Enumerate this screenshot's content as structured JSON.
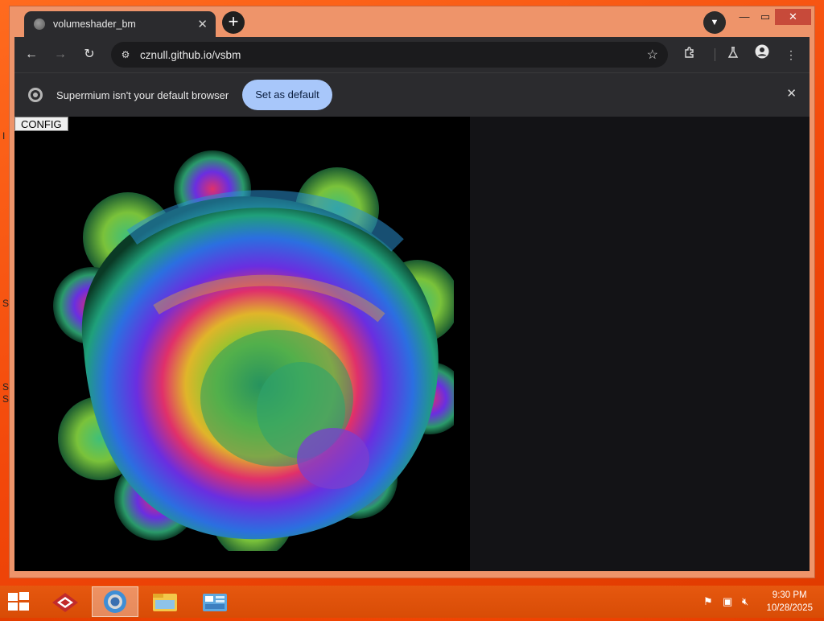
{
  "desktop": {
    "chars": [
      "I",
      "S",
      "S",
      "S"
    ]
  },
  "browser": {
    "tab": {
      "title": "volumeshader_bm",
      "close_label": "✕"
    },
    "new_tab_label": "+",
    "window_controls": {
      "minimize": "—",
      "maximize": "▭",
      "close": "✕"
    },
    "toolbar": {
      "back": "←",
      "forward": "→",
      "reload": "↻",
      "url": "cznull.github.io/vsbm",
      "star": "☆"
    },
    "infobar": {
      "message": "Supermium isn't your default browser",
      "button": "Set as default",
      "close": "✕"
    }
  },
  "page": {
    "config_button": "CONFIG"
  },
  "taskbar": {
    "apps": [
      "shader-app",
      "supermium-browser",
      "file-explorer",
      "control-panel"
    ],
    "clock": {
      "time": "9:30 PM",
      "date": "10/28/2025"
    }
  },
  "colors": {
    "accent": "#a8c7fa",
    "desktop": "#f2470a",
    "chrome_dark": "#2b2b2e"
  }
}
